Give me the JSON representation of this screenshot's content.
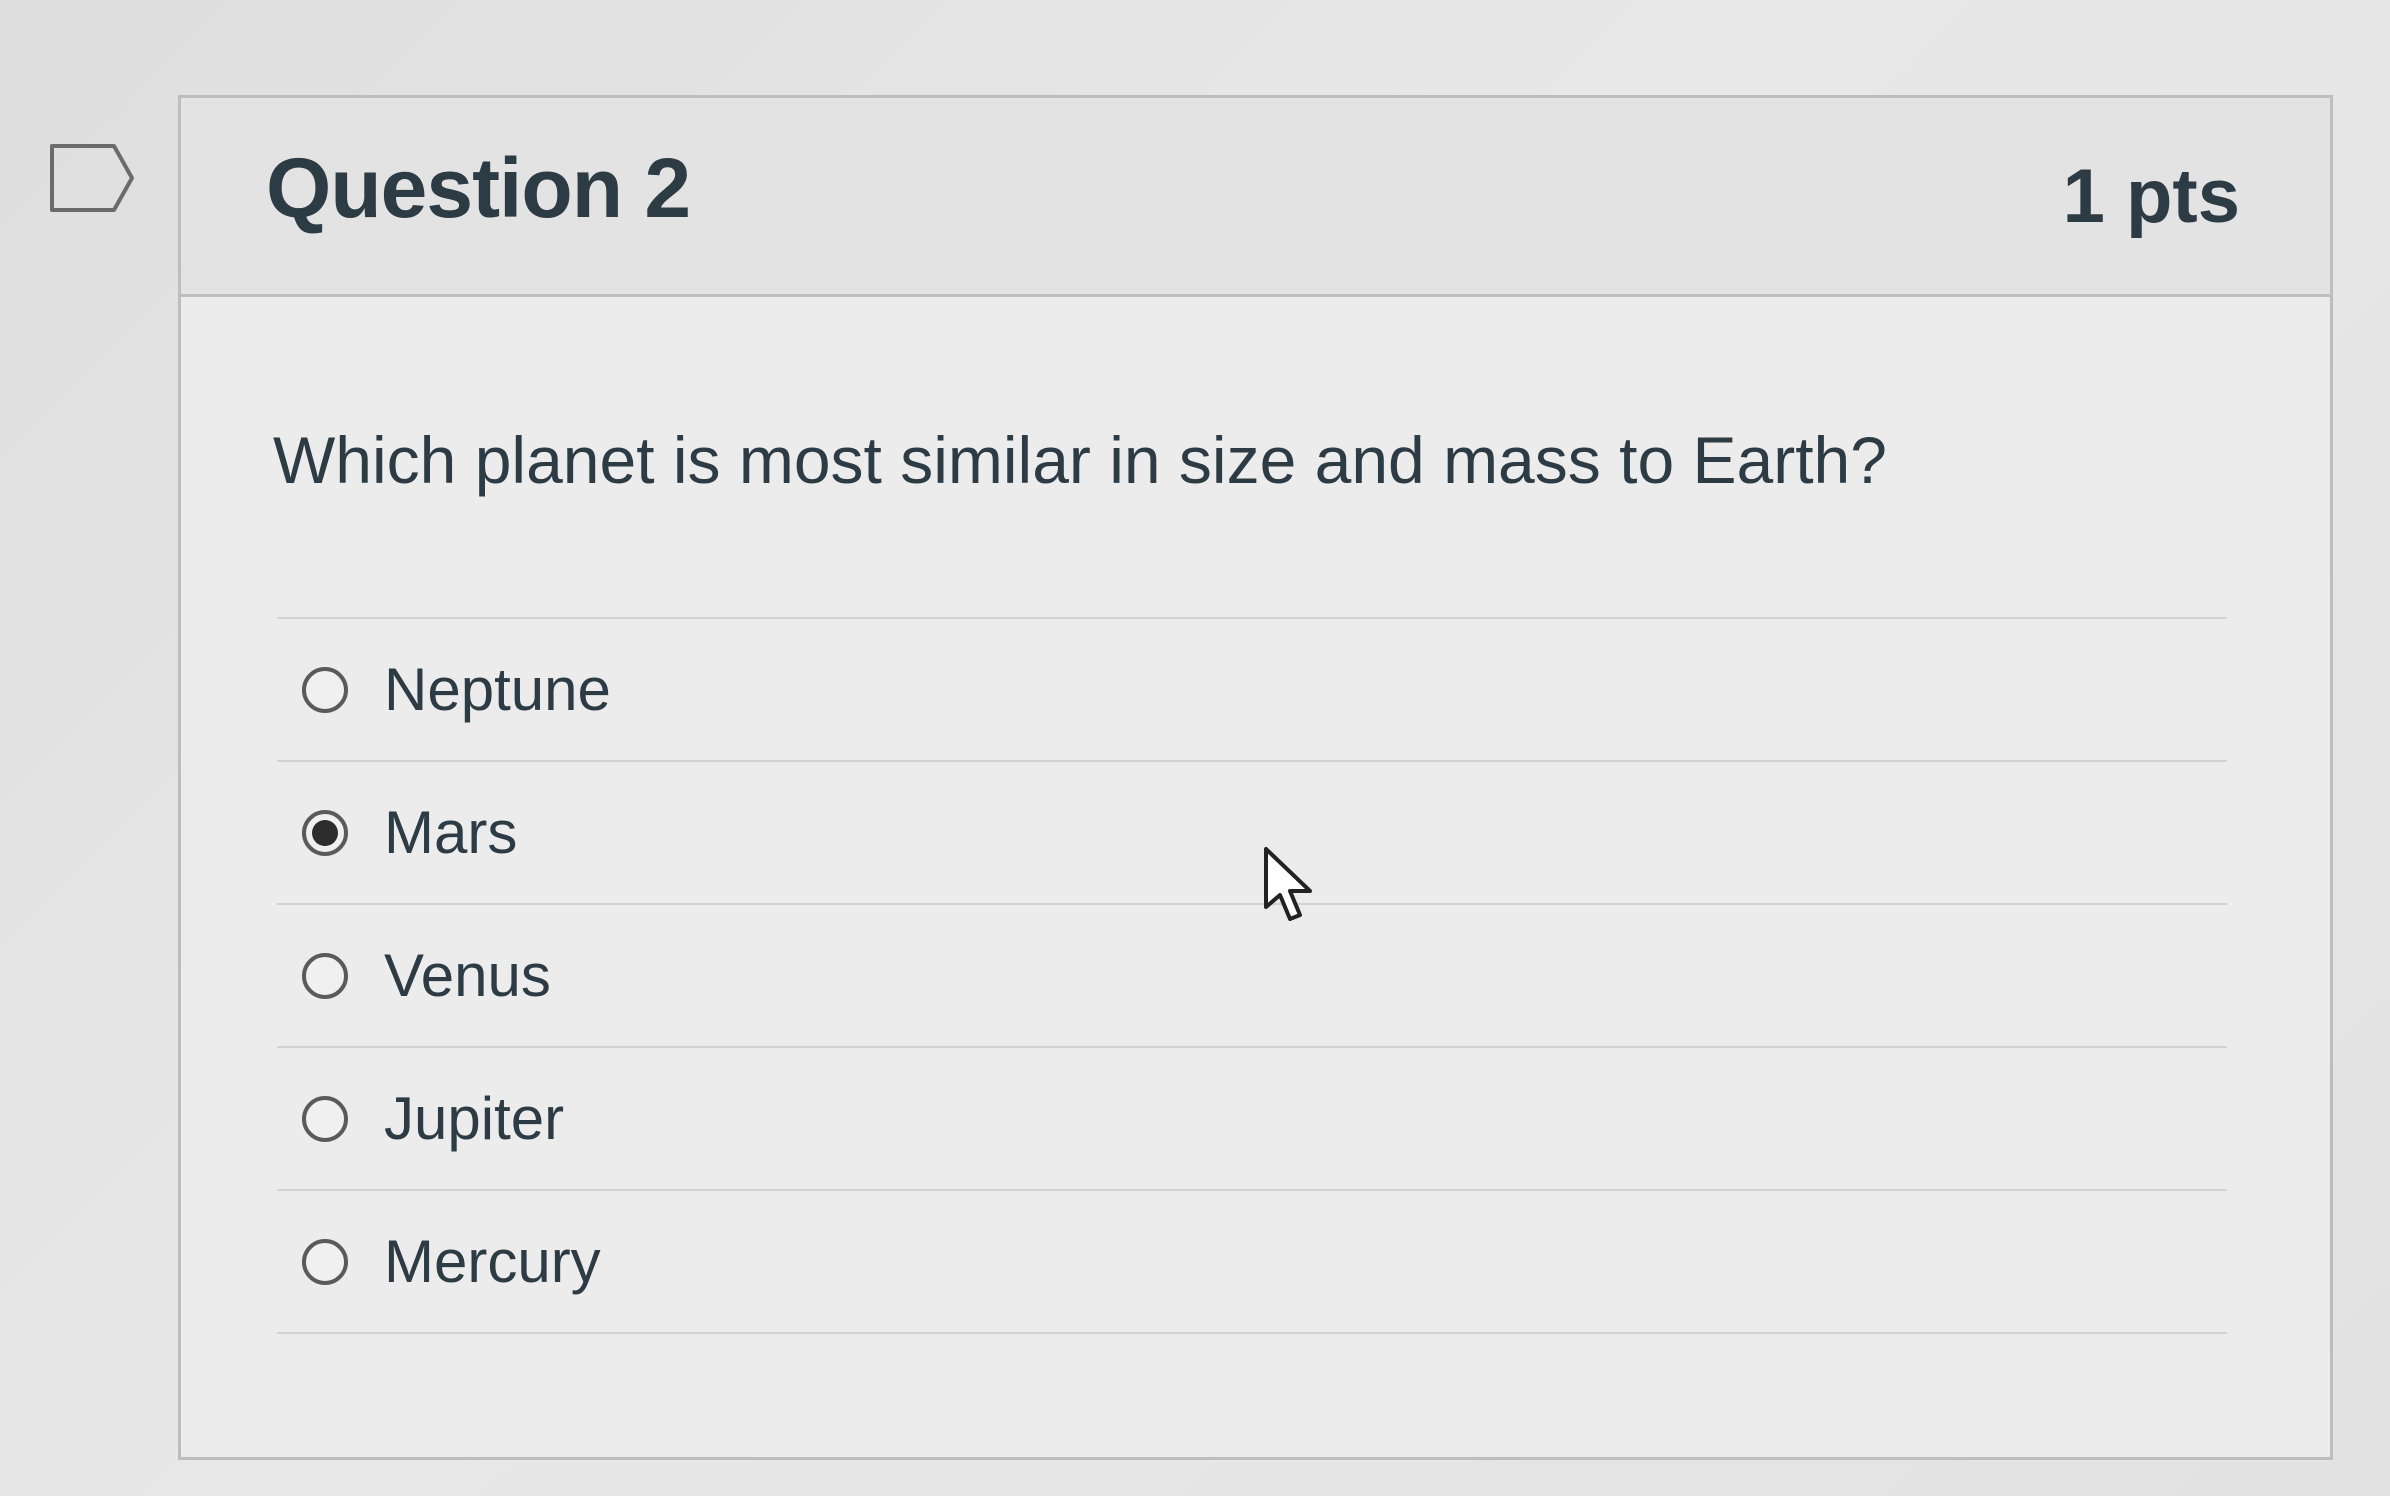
{
  "question": {
    "title": "Question 2",
    "points": "1 pts",
    "text": "Which planet is most similar in size and mass to Earth?",
    "flag_icon": "flag-outline-icon",
    "answers": [
      {
        "label": "Neptune",
        "selected": false
      },
      {
        "label": "Mars",
        "selected": true
      },
      {
        "label": "Venus",
        "selected": false
      },
      {
        "label": "Jupiter",
        "selected": false
      },
      {
        "label": "Mercury",
        "selected": false
      }
    ]
  },
  "cursor_icon": "mouse-pointer-icon"
}
